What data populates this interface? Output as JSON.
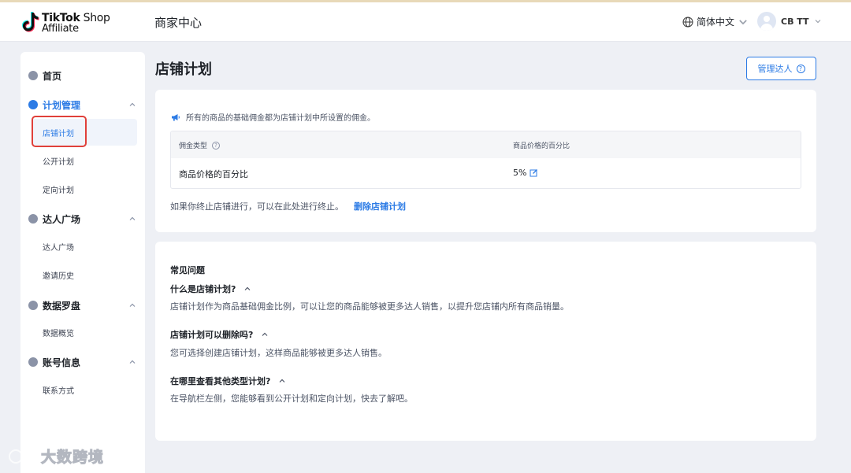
{
  "brand": {
    "line1_bold": "TikTok",
    "line1_thin": " Shop",
    "line2": "Affiliate"
  },
  "header": {
    "title": "商家中心",
    "language": "简体中文",
    "user_name": "CB TT"
  },
  "sidebar": {
    "home": "首页",
    "groups": [
      {
        "label": "计划管理",
        "items": [
          "店铺计划",
          "公开计划",
          "定向计划"
        ]
      },
      {
        "label": "达人广场",
        "items": [
          "达人广场",
          "邀请历史"
        ]
      },
      {
        "label": "数据罗盘",
        "items": [
          "数据概览"
        ]
      },
      {
        "label": "账号信息",
        "items": [
          "联系方式"
        ]
      }
    ]
  },
  "page": {
    "title": "店铺计划",
    "manage_button": "管理达人",
    "notice": "所有的商品的基础佣金都为店铺计划中所设置的佣金。",
    "table": {
      "headers": [
        "佣金类型",
        "商品价格的百分比"
      ],
      "row": {
        "type": "商品价格的百分比",
        "value": "5%"
      }
    },
    "terminate_text": "如果你终止店铺进行，可以在此处进行终止。",
    "terminate_link": "删除店铺计划"
  },
  "faq": {
    "title": "常见问题",
    "items": [
      {
        "q": "什么是店铺计划?",
        "a": "店铺计划作为商品基础佣金比例，可以让您的商品能够被更多达人销售，以提升您店铺内所有商品销量。"
      },
      {
        "q": "店铺计划可以删除吗?",
        "a": "您可选择创建店铺计划，这样商品能够被更多达人销售。"
      },
      {
        "q": "在哪里查看其他类型计划?",
        "a": "在导航栏左侧，您能够看到公开计划和定向计划，快去了解吧。"
      }
    ]
  },
  "watermark": "大数跨境",
  "colors": {
    "accent": "#2c7be5",
    "highlight": "#e0403a",
    "background": "#eef0f5"
  }
}
